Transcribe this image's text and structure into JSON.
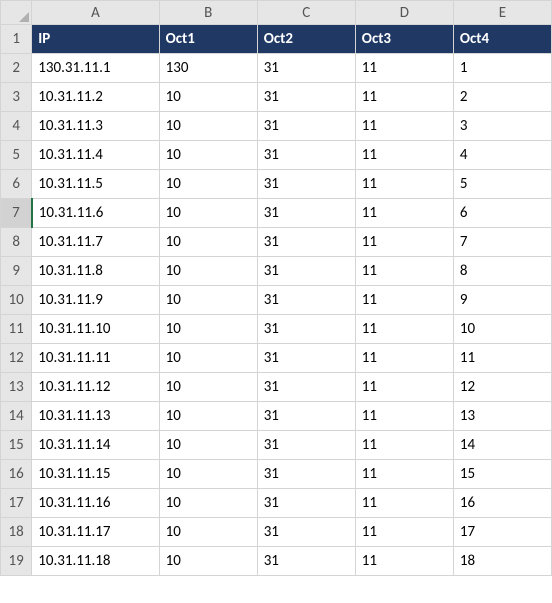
{
  "columns": [
    "A",
    "B",
    "C",
    "D",
    "E"
  ],
  "header_row_number": "1",
  "headers": {
    "A": "IP",
    "B": "Oct1",
    "C": "Oct2",
    "D": "Oct3",
    "E": "Oct4"
  },
  "selected_row": "7",
  "rows": [
    {
      "n": "2",
      "A": "130.31.11.1",
      "B": "130",
      "C": "31",
      "D": "11",
      "E": "1"
    },
    {
      "n": "3",
      "A": "10.31.11.2",
      "B": "10",
      "C": "31",
      "D": "11",
      "E": "2"
    },
    {
      "n": "4",
      "A": "10.31.11.3",
      "B": "10",
      "C": "31",
      "D": "11",
      "E": "3"
    },
    {
      "n": "5",
      "A": "10.31.11.4",
      "B": "10",
      "C": "31",
      "D": "11",
      "E": "4"
    },
    {
      "n": "6",
      "A": "10.31.11.5",
      "B": "10",
      "C": "31",
      "D": "11",
      "E": "5"
    },
    {
      "n": "7",
      "A": "10.31.11.6",
      "B": "10",
      "C": "31",
      "D": "11",
      "E": "6"
    },
    {
      "n": "8",
      "A": "10.31.11.7",
      "B": "10",
      "C": "31",
      "D": "11",
      "E": "7"
    },
    {
      "n": "9",
      "A": "10.31.11.8",
      "B": "10",
      "C": "31",
      "D": "11",
      "E": "8"
    },
    {
      "n": "10",
      "A": "10.31.11.9",
      "B": "10",
      "C": "31",
      "D": "11",
      "E": "9"
    },
    {
      "n": "11",
      "A": "10.31.11.10",
      "B": "10",
      "C": "31",
      "D": "11",
      "E": "10"
    },
    {
      "n": "12",
      "A": "10.31.11.11",
      "B": "10",
      "C": "31",
      "D": "11",
      "E": "11"
    },
    {
      "n": "13",
      "A": "10.31.11.12",
      "B": "10",
      "C": "31",
      "D": "11",
      "E": "12"
    },
    {
      "n": "14",
      "A": "10.31.11.13",
      "B": "10",
      "C": "31",
      "D": "11",
      "E": "13"
    },
    {
      "n": "15",
      "A": "10.31.11.14",
      "B": "10",
      "C": "31",
      "D": "11",
      "E": "14"
    },
    {
      "n": "16",
      "A": "10.31.11.15",
      "B": "10",
      "C": "31",
      "D": "11",
      "E": "15"
    },
    {
      "n": "17",
      "A": "10.31.11.16",
      "B": "10",
      "C": "31",
      "D": "11",
      "E": "16"
    },
    {
      "n": "18",
      "A": "10.31.11.17",
      "B": "10",
      "C": "31",
      "D": "11",
      "E": "17"
    },
    {
      "n": "19",
      "A": "10.31.11.18",
      "B": "10",
      "C": "31",
      "D": "11",
      "E": "18"
    }
  ]
}
